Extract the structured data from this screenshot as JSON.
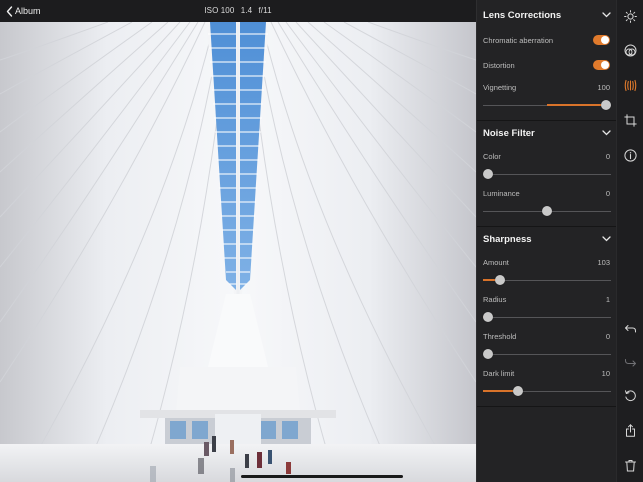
{
  "header": {
    "back_label": "Album",
    "exif": {
      "iso": "ISO 100",
      "shutter": "1.4",
      "aperture": "f/11"
    }
  },
  "panel": {
    "lens": {
      "title": "Lens Corrections",
      "chromatic_label": "Chromatic aberration",
      "chromatic_on": true,
      "distortion_label": "Distortion",
      "distortion_on": true,
      "vignetting_label": "Vignetting",
      "vignetting_value": "100",
      "vignetting_level": 1.0
    },
    "noise": {
      "title": "Noise Filter",
      "color_label": "Color",
      "color_value": "0",
      "color_level": 0.0,
      "luminance_label": "Luminance",
      "luminance_value": "0",
      "luminance_level": 0.5
    },
    "sharpness": {
      "title": "Sharpness",
      "amount_label": "Amount",
      "amount_value": "103",
      "amount_level": 0.13,
      "radius_label": "Radius",
      "radius_value": "1",
      "radius_level": 0.04,
      "threshold_label": "Threshold",
      "threshold_value": "0",
      "threshold_level": 0.0,
      "darklimit_label": "Dark limit",
      "darklimit_value": "10",
      "darklimit_level": 0.27
    }
  },
  "toolbar": {
    "icons": [
      "sun-icon",
      "color-balls-icon",
      "lens-correction-icon",
      "crop-icon",
      "info-icon",
      "undo-icon",
      "redo-icon",
      "reset-icon",
      "share-icon",
      "delete-icon"
    ],
    "accent": "#e07a2c"
  },
  "colors": {
    "accent": "#e07a2c",
    "panel": "#232325",
    "photo_bg": "#e9eaee"
  }
}
